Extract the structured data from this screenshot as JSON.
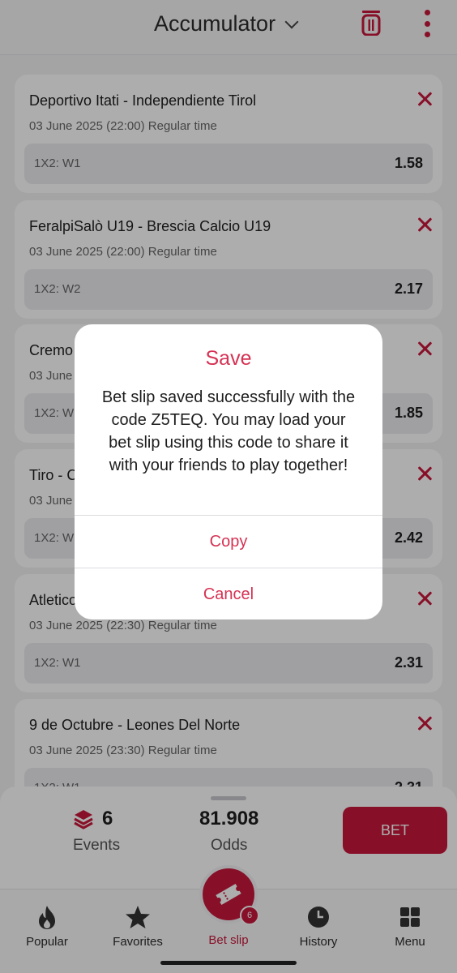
{
  "header": {
    "title": "Accumulator"
  },
  "cards": [
    {
      "match": "Deportivo Itati - Independiente Tirol",
      "date": "03 June 2025 (22:00) Regular time",
      "market": "1X2: W1",
      "odds": "1.58"
    },
    {
      "match": "FeralpiSalò U19 - Brescia Calcio U19",
      "date": "03 June 2025 (22:00) Regular time",
      "market": "1X2: W2",
      "odds": "2.17"
    },
    {
      "match": "Cremo",
      "date": "03 June",
      "market": "1X2: W",
      "odds": "1.85"
    },
    {
      "match": "Tiro - C",
      "date": "03 June",
      "market": "1X2: W",
      "odds": "2.42"
    },
    {
      "match": "Atletico",
      "date": "03 June 2025 (22:30) Regular time",
      "market": "1X2: W1",
      "odds": "2.31"
    },
    {
      "match": "9 de Octubre - Leones Del Norte",
      "date": "03 June 2025 (23:30) Regular time",
      "market": "1X2: W1",
      "odds": "2.31"
    }
  ],
  "summary": {
    "events_count": "6",
    "events_label": "Events",
    "odds_value": "81.908",
    "odds_label": "Odds",
    "bet_label": "BET"
  },
  "nav": {
    "popular": "Popular",
    "favorites": "Favorites",
    "betslip": "Bet slip",
    "history": "History",
    "menu": "Menu",
    "badge": "6"
  },
  "dialog": {
    "title": "Save",
    "message": "Bet slip saved successfully with the code Z5TEQ. You may load your bet slip using this code to share it with your friends to play together!",
    "copy": "Copy",
    "cancel": "Cancel"
  },
  "colors": {
    "accent": "#c8193c",
    "dialog_accent": "#d63253"
  }
}
